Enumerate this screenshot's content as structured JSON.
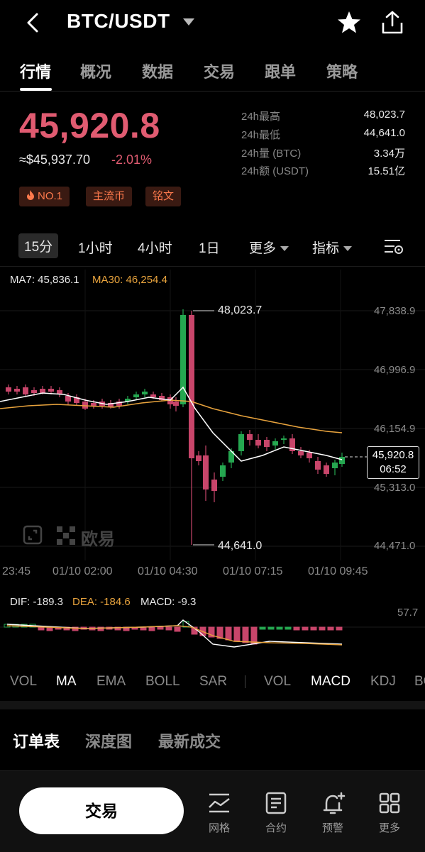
{
  "header": {
    "title": "BTC/USDT",
    "back_icon": "chevron-left-icon",
    "star_icon": "star-icon",
    "share_icon": "share-icon"
  },
  "tabs": [
    {
      "label": "行情",
      "active": true
    },
    {
      "label": "概况",
      "active": false
    },
    {
      "label": "数据",
      "active": false
    },
    {
      "label": "交易",
      "active": false
    },
    {
      "label": "跟单",
      "active": false
    },
    {
      "label": "策略",
      "active": false
    }
  ],
  "ticker": {
    "price": "45,920.8",
    "usd_equiv": "≈$45,937.70",
    "change": "-2.01%",
    "tags": [
      "NO.1",
      "主流币",
      "铭文"
    ],
    "stats": [
      {
        "label": "24h最高",
        "value": "48,023.7"
      },
      {
        "label": "24h最低",
        "value": "44,641.0"
      },
      {
        "label": "24h量 (BTC)",
        "value": "3.34万"
      },
      {
        "label": "24h额 (USDT)",
        "value": "15.51亿"
      }
    ]
  },
  "intervals": {
    "items": [
      "15分",
      "1小时",
      "4小时",
      "1日"
    ],
    "more": "更多",
    "indicator": "指标"
  },
  "chart": {
    "ma7_label": "MA7: 45,836.1",
    "ma30_label": "MA30: 46,254.4",
    "y_ticks": [
      "47,838.9",
      "46,996.9",
      "46,154.9",
      "45,313.0",
      "44,471.0"
    ],
    "x_ticks": [
      "23:45",
      "01/10 02:00",
      "01/10 04:30",
      "01/10 07:15",
      "01/10 09:45"
    ],
    "high_annotation": "48,023.7",
    "low_annotation": "44,641.0",
    "current_price": "45,920.8",
    "countdown": "06:52",
    "watermark": "欧易",
    "up_color": "#25a750",
    "down_color": "#c8456a",
    "ma7_color": "#ffffff",
    "ma30_color": "#e8a33d"
  },
  "macd": {
    "dif": "DIF: -189.3",
    "dea": "DEA: -184.6",
    "macd": "MACD: -9.3",
    "y_tick": "57.7"
  },
  "indicators": {
    "main": [
      "VOL",
      "MA",
      "EMA",
      "BOLL",
      "SAR"
    ],
    "sub": [
      "VOL",
      "MACD",
      "KDJ",
      "BO"
    ]
  },
  "orderbook_tabs": [
    "订单表",
    "深度图",
    "最新成交"
  ],
  "bottom": {
    "trade_label": "交易",
    "nav": [
      {
        "label": "网格",
        "icon": "grid-chart-icon"
      },
      {
        "label": "合约",
        "icon": "contract-icon"
      },
      {
        "label": "预警",
        "icon": "bell-plus-icon"
      },
      {
        "label": "更多",
        "icon": "apps-icon"
      }
    ]
  }
}
